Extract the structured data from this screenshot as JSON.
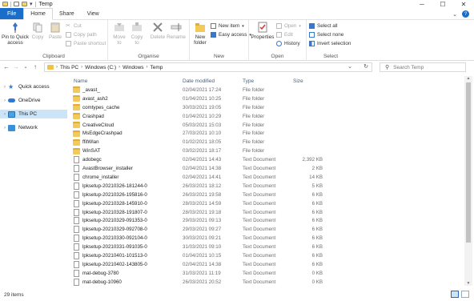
{
  "window": {
    "title": "Temp"
  },
  "colors": {
    "accent": "#1a6ec9",
    "folder": "#f3c95a",
    "selected": "#cce4f7"
  },
  "tabs": [
    {
      "label": "File"
    },
    {
      "label": "Home"
    },
    {
      "label": "Share"
    },
    {
      "label": "View"
    }
  ],
  "ribbon": {
    "clipboard": {
      "label": "Clipboard",
      "pin": "Pin to Quick access",
      "copy": "Copy",
      "paste": "Paste",
      "cut": "Cut",
      "copy_path": "Copy path",
      "paste_shortcut": "Paste shortcut"
    },
    "organise": {
      "label": "Organise",
      "move_to": "Move to",
      "copy_to": "Copy to",
      "delete": "Delete",
      "rename": "Rename"
    },
    "new": {
      "label": "New",
      "new_folder": "New folder",
      "new_item": "New item",
      "easy_access": "Easy access"
    },
    "open": {
      "label": "Open",
      "properties": "Properties",
      "open": "Open",
      "edit": "Edit",
      "history": "History"
    },
    "select": {
      "label": "Select",
      "select_all": "Select all",
      "select_none": "Select none",
      "invert_selection": "Invert selection"
    }
  },
  "address": {
    "crumbs": [
      "This PC",
      "Windows (C:)",
      "Windows",
      "Temp"
    ],
    "search_placeholder": "Search Temp"
  },
  "nav": [
    {
      "label": "Quick access",
      "icon": "star-icon"
    },
    {
      "label": "OneDrive",
      "icon": "cloud-icon"
    },
    {
      "label": "This PC",
      "icon": "computer-icon"
    },
    {
      "label": "Network",
      "icon": "network-icon"
    }
  ],
  "columns": {
    "name": "Name",
    "date": "Date modified",
    "type": "Type",
    "size": "Size"
  },
  "files": [
    {
      "name": "_avast_",
      "date": "02/04/2021 17:24",
      "type": "File folder",
      "size": "",
      "kind": "folder"
    },
    {
      "name": "avast_ash2",
      "date": "01/04/2021 10:25",
      "type": "File folder",
      "size": "",
      "kind": "folder"
    },
    {
      "name": "comtypes_cache",
      "date": "30/03/2021 19:05",
      "type": "File folder",
      "size": "",
      "kind": "folder"
    },
    {
      "name": "Crashpad",
      "date": "01/04/2021 10:29",
      "type": "File folder",
      "size": "",
      "kind": "folder"
    },
    {
      "name": "CreativeCloud",
      "date": "05/03/2021 15:03",
      "type": "File folder",
      "size": "",
      "kind": "folder"
    },
    {
      "name": "MsEdgeCrashpad",
      "date": "27/03/2021 10:10",
      "type": "File folder",
      "size": "",
      "kind": "folder"
    },
    {
      "name": "ffitWlan",
      "date": "01/02/2021 18:05",
      "type": "File folder",
      "size": "",
      "kind": "folder"
    },
    {
      "name": "WinSAT",
      "date": "03/02/2021 18:17",
      "type": "File folder",
      "size": "",
      "kind": "folder"
    },
    {
      "name": "adobegc",
      "date": "02/04/2021 14:43",
      "type": "Text Document",
      "size": "2,392 KB",
      "kind": "doc"
    },
    {
      "name": "AvastBrowser_installer",
      "date": "02/04/2021 14:38",
      "type": "Text Document",
      "size": "2 KB",
      "kind": "doc"
    },
    {
      "name": "chrome_installer",
      "date": "02/04/2021 14:41",
      "type": "Text Document",
      "size": "14 KB",
      "kind": "doc"
    },
    {
      "name": "lpksetup-20210326-181244-0",
      "date": "26/03/2021 18:12",
      "type": "Text Document",
      "size": "5 KB",
      "kind": "doc"
    },
    {
      "name": "lpksetup-20210326-195816-0",
      "date": "26/03/2021 19:58",
      "type": "Text Document",
      "size": "6 KB",
      "kind": "doc"
    },
    {
      "name": "lpksetup-20210328-145910-0",
      "date": "28/03/2021 14:59",
      "type": "Text Document",
      "size": "6 KB",
      "kind": "doc"
    },
    {
      "name": "lpksetup-20210328-191807-0",
      "date": "28/03/2021 19:18",
      "type": "Text Document",
      "size": "6 KB",
      "kind": "doc"
    },
    {
      "name": "lpksetup-20210329-091353-0",
      "date": "29/03/2021 09:13",
      "type": "Text Document",
      "size": "6 KB",
      "kind": "doc"
    },
    {
      "name": "lpksetup-20210329-092708-0",
      "date": "29/03/2021 09:27",
      "type": "Text Document",
      "size": "6 KB",
      "kind": "doc"
    },
    {
      "name": "lpksetup-20210330-092104-0",
      "date": "30/03/2021 09:21",
      "type": "Text Document",
      "size": "6 KB",
      "kind": "doc"
    },
    {
      "name": "lpksetup-20210331-091035-0",
      "date": "31/03/2021 09:10",
      "type": "Text Document",
      "size": "6 KB",
      "kind": "doc"
    },
    {
      "name": "lpksetup-20210401-101513-0",
      "date": "01/04/2021 10:15",
      "type": "Text Document",
      "size": "6 KB",
      "kind": "doc"
    },
    {
      "name": "lpksetup-20210402-143805-0",
      "date": "02/04/2021 14:38",
      "type": "Text Document",
      "size": "6 KB",
      "kind": "doc"
    },
    {
      "name": "mat-debug-3780",
      "date": "31/03/2021 11:19",
      "type": "Text Document",
      "size": "0 KB",
      "kind": "doc"
    },
    {
      "name": "mat-debug-10960",
      "date": "26/03/2021 20:52",
      "type": "Text Document",
      "size": "0 KB",
      "kind": "doc"
    }
  ],
  "status": {
    "items_count": "29 items"
  }
}
